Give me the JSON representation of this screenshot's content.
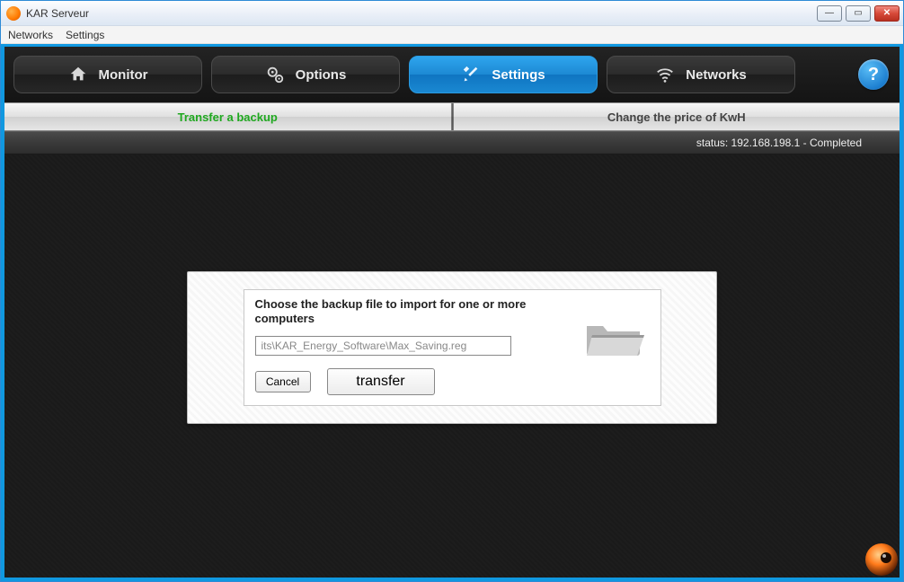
{
  "window": {
    "title": "KAR Serveur"
  },
  "menubar": {
    "items": [
      "Networks",
      "Settings"
    ]
  },
  "tabs": [
    {
      "label": "Monitor",
      "icon": "home-icon",
      "active": false
    },
    {
      "label": "Options",
      "icon": "gears-icon",
      "active": false
    },
    {
      "label": "Settings",
      "icon": "tools-icon",
      "active": true
    },
    {
      "label": "Networks",
      "icon": "wifi-icon",
      "active": false
    }
  ],
  "help_label": "?",
  "subtabs": {
    "left": {
      "label": "Transfer a backup",
      "active": true
    },
    "right": {
      "label": "Change the price of KwH",
      "active": false
    }
  },
  "status": {
    "prefix": "status:",
    "ip": "192.168.198.1",
    "state": "Completed",
    "full": "status: 192.168.198.1 - Completed"
  },
  "dialog": {
    "prompt": "Choose the backup file to import for one or more computers",
    "file_path_visible": "its\\KAR_Energy_Software\\Max_Saving.reg",
    "cancel_label": "Cancel",
    "transfer_label": "transfer"
  },
  "winbtns": {
    "min": "—",
    "max": "▭",
    "close": "✕"
  }
}
